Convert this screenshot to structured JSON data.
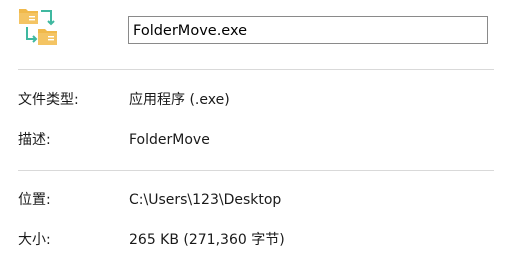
{
  "file": {
    "name": "FolderMove.exe",
    "icon": "folder-move-icon"
  },
  "properties": {
    "type": {
      "label": "文件类型:",
      "value": "应用程序 (.exe)"
    },
    "description": {
      "label": "描述:",
      "value": "FolderMove"
    },
    "location": {
      "label": "位置:",
      "value": "C:\\Users\\123\\Desktop"
    },
    "size": {
      "label": "大小:",
      "value": "265 KB (271,360 字节)"
    }
  },
  "colors": {
    "folder": "#f0b94b",
    "folder_dark": "#dfa235",
    "arrow": "#3fb8a0",
    "divider": "#d9d9d9",
    "input_border": "#8a8a8a"
  }
}
